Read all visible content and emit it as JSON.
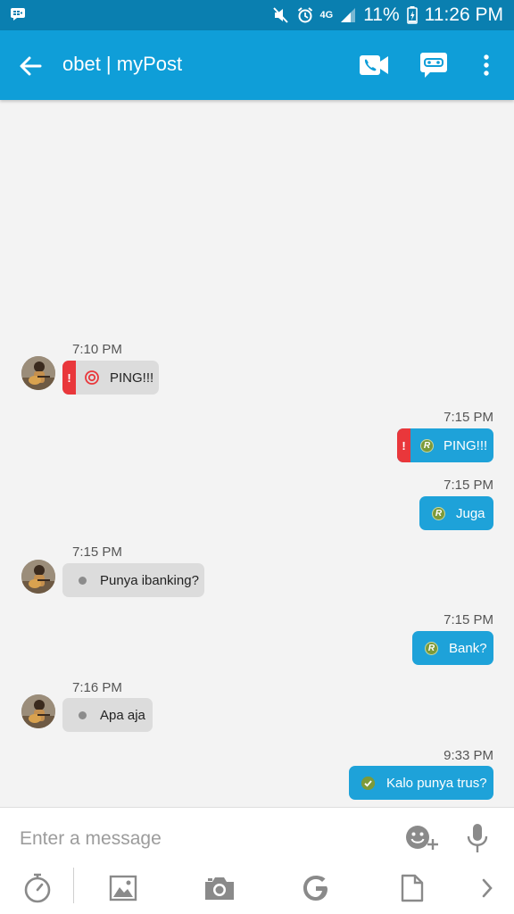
{
  "status_bar": {
    "network": "4G",
    "battery": "11%",
    "time": "11:26 PM",
    "icons": [
      "bbm-notification-icon",
      "mute-icon",
      "alarm-icon",
      "signal-icon",
      "battery-charging-icon"
    ]
  },
  "header": {
    "title": "obet | myPost",
    "actions": [
      "video-call-icon",
      "voice-chat-icon",
      "more-icon"
    ],
    "color": "#0f9ed8"
  },
  "messages": [
    {
      "time": "7:10 PM",
      "direction": "incoming",
      "text": "PING!!!",
      "alert": "!",
      "status": "ping"
    },
    {
      "time": "7:15 PM",
      "direction": "outgoing",
      "text": "PING!!!",
      "alert": "!",
      "status": "R"
    },
    {
      "time": "7:15 PM",
      "direction": "outgoing",
      "text": "Juga",
      "status": "R"
    },
    {
      "time": "7:15 PM",
      "direction": "incoming",
      "text": "Punya ibanking?",
      "status": "dot"
    },
    {
      "time": "7:15 PM",
      "direction": "outgoing",
      "text": "Bank?",
      "status": "R"
    },
    {
      "time": "7:16 PM",
      "direction": "incoming",
      "text": "Apa aja",
      "status": "dot"
    },
    {
      "time": "9:33 PM",
      "direction": "outgoing",
      "text": "Kalo punya trus?",
      "status": "check"
    }
  ],
  "composer": {
    "placeholder": "Enter a message",
    "tools": [
      "timer-icon",
      "image-icon",
      "camera-icon",
      "google-icon",
      "file-icon",
      "chevron-right-icon"
    ]
  },
  "colors": {
    "outgoing_bubble": "#1ea2d9",
    "incoming_bubble": "#dcdcdc",
    "alert": "#e9373b",
    "status_bar": "#0a7fb0"
  }
}
